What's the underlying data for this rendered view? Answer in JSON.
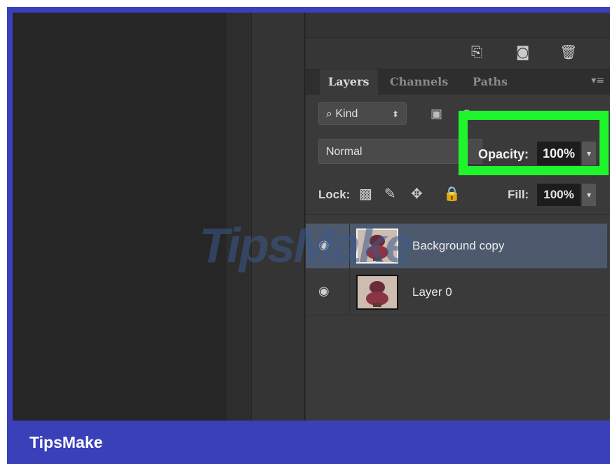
{
  "toolbar_icons": [
    "new-layer-icon",
    "camera-icon",
    "trash-icon"
  ],
  "tabs": [
    {
      "label": "Layers",
      "active": true
    },
    {
      "label": "Channels",
      "active": false
    },
    {
      "label": "Paths",
      "active": false
    }
  ],
  "filter": {
    "kind_label": "Kind",
    "icons": [
      "image-filter-icon",
      "adjustment-filter-icon",
      "type-filter-icon",
      "shape-filter-icon",
      "smart-object-filter-icon"
    ]
  },
  "blend": {
    "mode": "Normal"
  },
  "opacity": {
    "label": "Opacity:",
    "value": "100%"
  },
  "lock": {
    "label": "Lock:",
    "icons": [
      "lock-transparent-icon",
      "lock-paint-icon",
      "lock-move-icon",
      "lock-all-icon"
    ]
  },
  "fill": {
    "label": "Fill:",
    "value": "100%"
  },
  "layers": [
    {
      "name": "Background copy",
      "selected": true,
      "visible": true
    },
    {
      "name": "Layer 0",
      "selected": false,
      "visible": true
    }
  ],
  "highlight_color": "#1ef52c",
  "watermark": "TipsMake",
  "footer": {
    "brand": "TipsMake"
  }
}
